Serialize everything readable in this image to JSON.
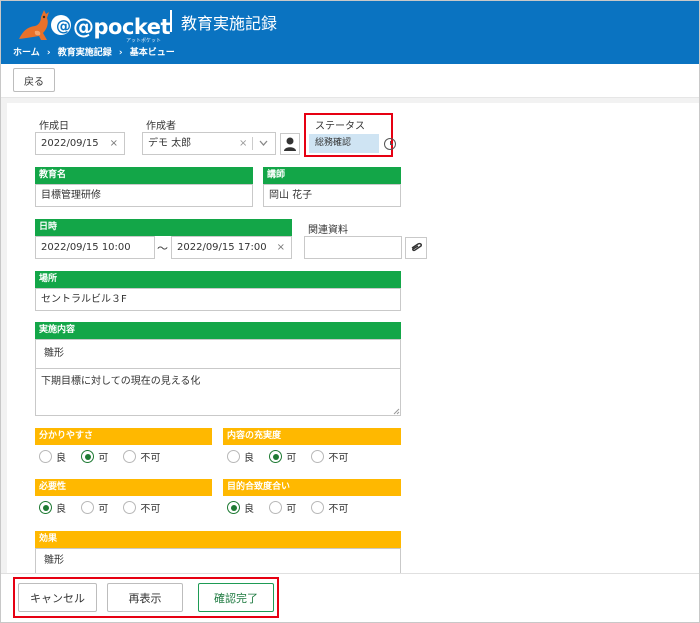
{
  "header": {
    "logo_text": "@pocket",
    "logo_sub": "アットポケット",
    "title": "教育実施記録",
    "breadcrumb": [
      "ホーム",
      "›",
      "教育実施記録",
      "›",
      "基本ビュー"
    ]
  },
  "toolbar": {
    "back_label": "戻る"
  },
  "form": {
    "created_date_label": "作成日",
    "created_date_value": "2022/09/15",
    "creator_label": "作成者",
    "creator_value": "デモ 太郎",
    "status_label": "ステータス",
    "status_value": "総務確認",
    "course_label": "教育名",
    "course_value": "目標管理研修",
    "instructor_label": "講師",
    "instructor_value": "岡山 花子",
    "datetime_label": "日時",
    "datetime_start": "2022/09/15 10:00",
    "datetime_sep": "〜",
    "datetime_end": "2022/09/15 17:00",
    "related_label": "関連資料",
    "location_label": "場所",
    "location_value": "セントラルビル３F",
    "details_label": "実施内容",
    "details_title": "雛形",
    "details_body": "下期目標に対しての現在の見える化",
    "clarity_label": "分かりやすさ",
    "content_label": "内容の充実度",
    "necessity_label": "必要性",
    "goal_label": "目的合致度合い",
    "effect_label": "効果",
    "effect_value": "雛形",
    "options": {
      "good": "良",
      "ok": "可",
      "bad": "不可"
    },
    "ratings": {
      "clarity": "ok",
      "content": "ok",
      "necessity": "good",
      "goal": "good"
    },
    "clear_symbol": "×"
  },
  "footer": {
    "cancel_label": "キャンセル",
    "reload_label": "再表示",
    "confirm_label": "確認完了"
  },
  "colors": {
    "header_bg": "#0a73c1",
    "green_band": "#13a648",
    "yellow_band": "#ffb800",
    "highlight": "#e60012",
    "status_bg": "#cfe4f3"
  }
}
